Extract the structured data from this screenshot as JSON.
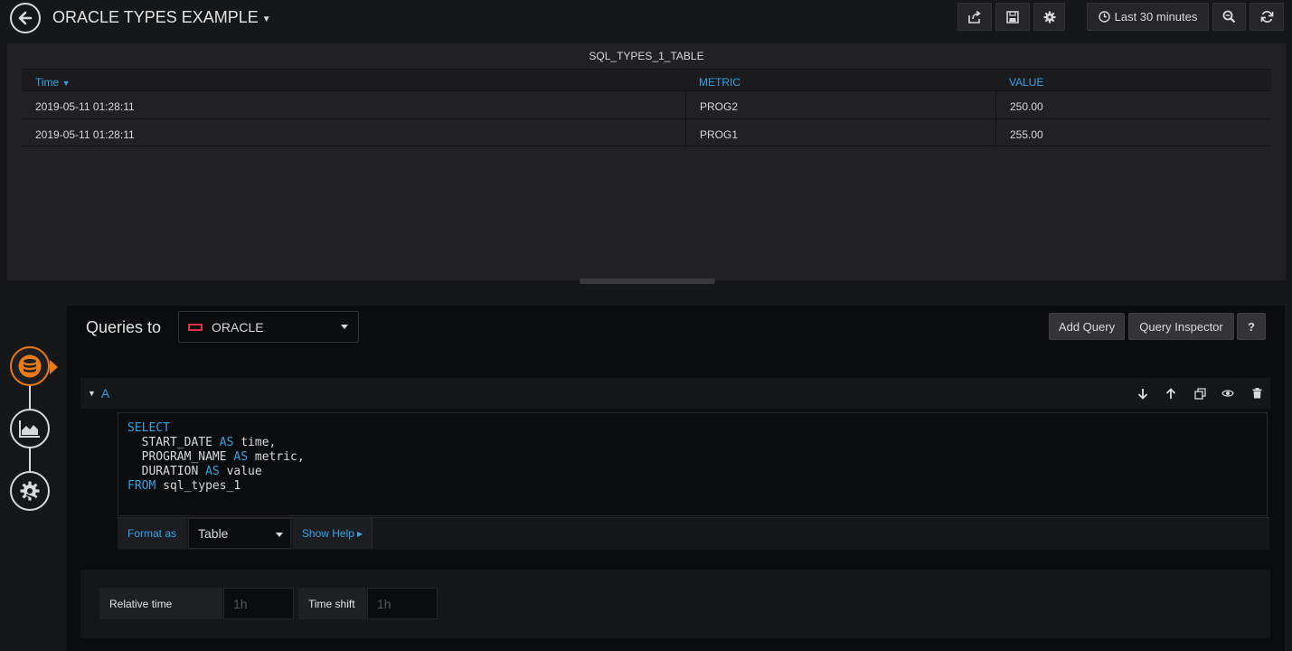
{
  "topbar": {
    "title": "ORACLE TYPES EXAMPLE",
    "time_range": "Last 30 minutes",
    "icons": [
      "back-arrow-icon",
      "share-icon",
      "save-icon",
      "gear-icon",
      "clock-icon",
      "zoom-out-icon",
      "refresh-icon"
    ]
  },
  "panel": {
    "title": "SQL_TYPES_1_TABLE",
    "columns": [
      "Time",
      "METRIC",
      "VALUE"
    ],
    "rows": [
      [
        "2019-05-11 01:28:11",
        "PROG2",
        "250.00"
      ],
      [
        "2019-05-11 01:28:11",
        "PROG1",
        "255.00"
      ]
    ]
  },
  "query_editor": {
    "queries_to_label": "Queries to",
    "datasource": "ORACLE",
    "add_query": "Add Query",
    "query_inspector": "Query Inspector",
    "help": "?",
    "query_name": "A",
    "sql_lines": [
      {
        "kw": "SELECT",
        "rest": ""
      },
      {
        "kw": "",
        "rest": "  START_DATE ",
        "kw2": "AS",
        "rest2": " time,"
      },
      {
        "kw": "",
        "rest": "  PROGRAM_NAME ",
        "kw2": "AS",
        "rest2": " metric,"
      },
      {
        "kw": "",
        "rest": "  DURATION ",
        "kw2": "AS",
        "rest2": " value"
      },
      {
        "kw": "FROM",
        "rest": " sql_types_1"
      }
    ],
    "format_as_label": "Format as",
    "format_as_value": "Table",
    "show_help": "Show Help",
    "relative_time_label": "Relative time",
    "relative_time_placeholder": "1h",
    "time_shift_label": "Time shift",
    "time_shift_placeholder": "1h"
  },
  "colors": {
    "accent": "#33a2e5",
    "active_step": "#eb7b18",
    "background": "#161719",
    "panel": "#212124"
  }
}
